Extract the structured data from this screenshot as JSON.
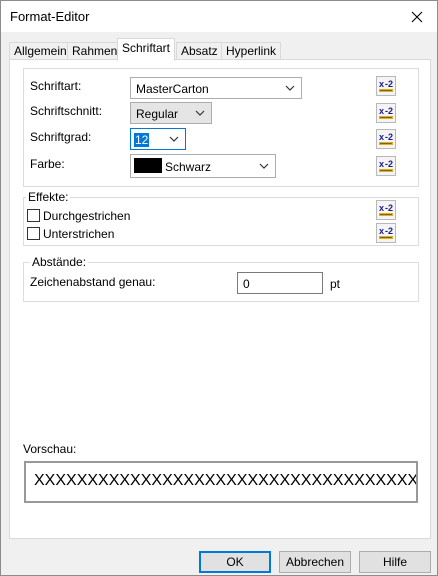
{
  "window": {
    "title": "Format-Editor"
  },
  "tabs": [
    "Allgemein",
    "Rahmen",
    "Schriftart",
    "Absatz",
    "Hyperlink"
  ],
  "font": {
    "schriftart_label": "Schriftart:",
    "schriftart_value": "MasterCarton",
    "schnitt_label": "Schriftschnitt:",
    "schnitt_value": "Regular",
    "grad_label": "Schriftgrad:",
    "grad_value": "12",
    "farbe_label": "Farbe:",
    "farbe_value": "Schwarz",
    "farbe_color": "#000000"
  },
  "effects": {
    "group_label": "Effekte:",
    "strike_label": "Durchgestrichen",
    "underline_label": "Unterstrichen"
  },
  "spacing": {
    "group_label": "Abstände:",
    "char_spacing_label": "Zeichenabstand genau:",
    "char_spacing_value": "0",
    "unit": "pt"
  },
  "preview": {
    "label": "Vorschau:",
    "text": "XXXXXXXXXXXXXXXXXXXXXXXXXXXXXXXXXXXXXXXXX"
  },
  "buttons": {
    "ok": "OK",
    "cancel": "Abbrechen",
    "help": "Hilfe"
  },
  "icons": {
    "reset": "x2-reset-icon"
  }
}
